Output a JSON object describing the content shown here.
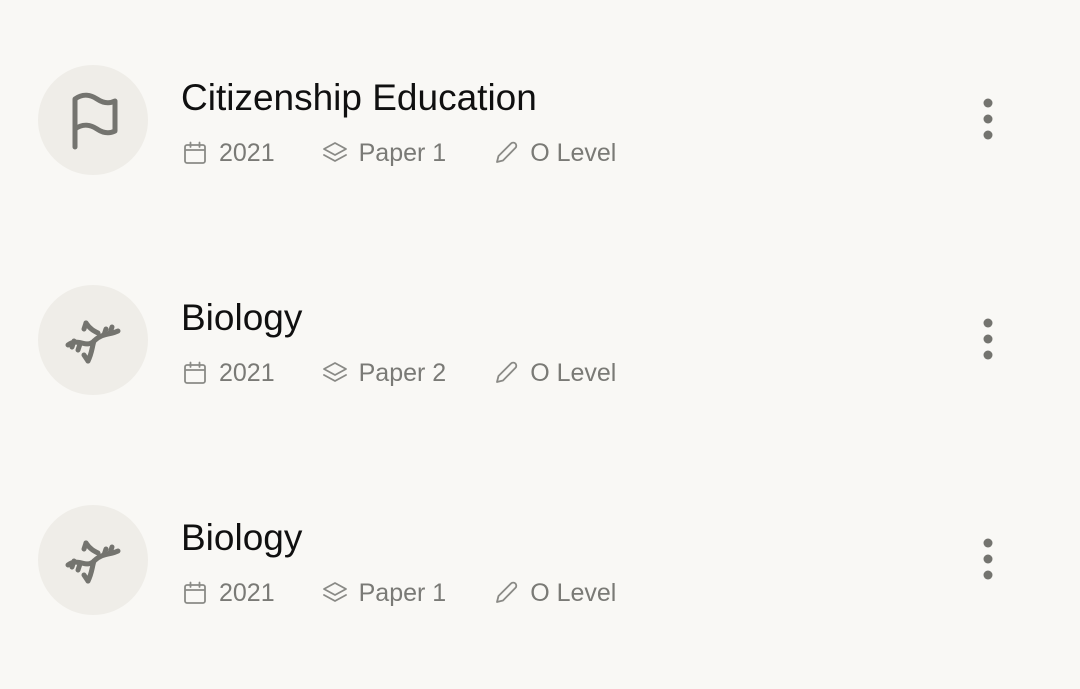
{
  "colors": {
    "background": "#f9f8f5",
    "avatar_bg": "#efede8",
    "icon": "#74746f",
    "title": "#101010",
    "meta_text": "#7a7a76"
  },
  "papers": [
    {
      "icon": "flag-icon",
      "title": "Citizenship Education",
      "year": "2021",
      "paper": "Paper 1",
      "level": "O Level"
    },
    {
      "icon": "dna-icon",
      "title": "Biology",
      "year": "2021",
      "paper": "Paper 2",
      "level": "O Level"
    },
    {
      "icon": "dna-icon",
      "title": "Biology",
      "year": "2021",
      "paper": "Paper 1",
      "level": "O Level"
    }
  ]
}
